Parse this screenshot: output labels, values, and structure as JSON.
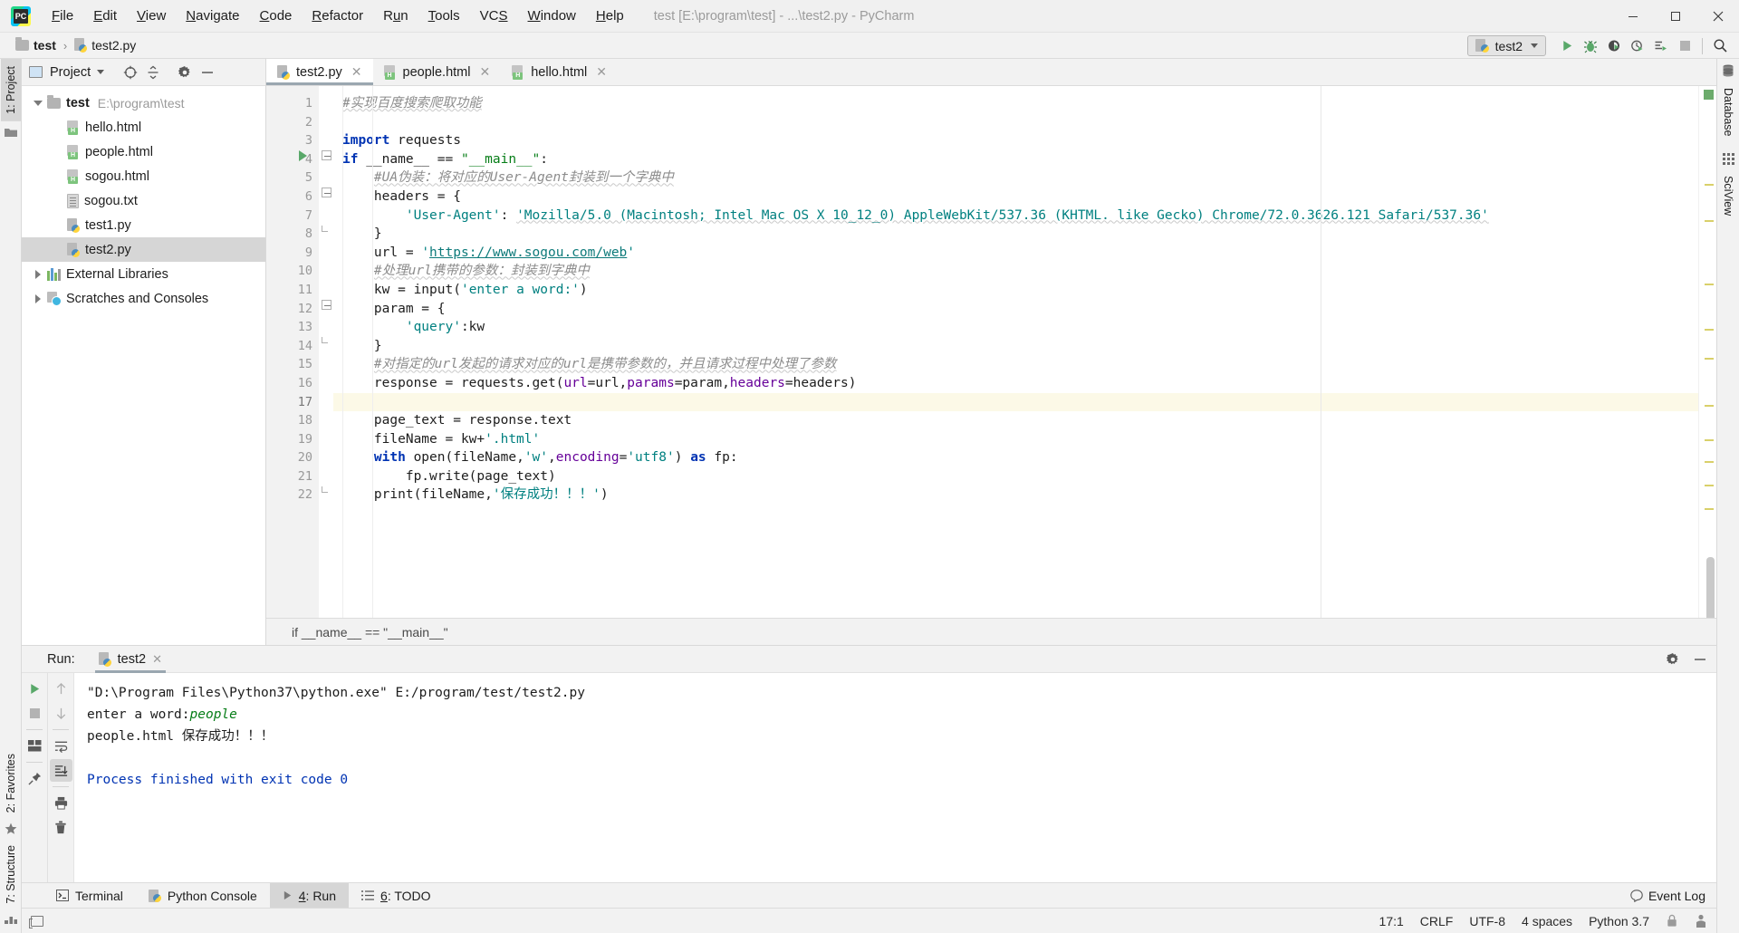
{
  "window": {
    "title": "test [E:\\program\\test] - ...\\test2.py - PyCharm",
    "app_icon": "pycharm-logo",
    "minimize": "—",
    "maximize": "❐",
    "close": "✕"
  },
  "menubar": {
    "items": [
      {
        "label": "File"
      },
      {
        "label": "Edit"
      },
      {
        "label": "View"
      },
      {
        "label": "Navigate"
      },
      {
        "label": "Code"
      },
      {
        "label": "Refactor"
      },
      {
        "label": "Run"
      },
      {
        "label": "Tools"
      },
      {
        "label": "VCS"
      },
      {
        "label": "Window"
      },
      {
        "label": "Help"
      }
    ]
  },
  "navbar": {
    "breadcrumbs": [
      {
        "label": "test",
        "icon": "folder-icon"
      },
      {
        "label": "test2.py",
        "icon": "python-file-icon"
      }
    ],
    "separator": "›",
    "run_config": {
      "label": "test2",
      "icon": "python-icon",
      "dropdown": "chevron-down-icon"
    },
    "buttons": [
      {
        "name": "run-button",
        "tip": "Run"
      },
      {
        "name": "debug-button",
        "tip": "Debug"
      },
      {
        "name": "run-with-coverage-button",
        "tip": "Run with Coverage"
      },
      {
        "name": "profile-button",
        "tip": "Profile"
      },
      {
        "name": "attach-to-process-button",
        "tip": "Attach"
      },
      {
        "name": "stop-button",
        "tip": "Stop"
      },
      {
        "name": "search-everywhere-button",
        "tip": "Search Everywhere"
      }
    ]
  },
  "left_strip": {
    "top": [
      {
        "label": "1: Project",
        "active": true
      }
    ],
    "bottom": [
      {
        "label": "2: Favorites",
        "active": false
      },
      {
        "label": "7: Structure",
        "active": false
      }
    ]
  },
  "right_strip": {
    "items": [
      {
        "label": "Database",
        "icon": "database-icon"
      },
      {
        "label": "SciView",
        "icon": "grid-icon"
      }
    ]
  },
  "project_panel": {
    "title": "Project",
    "toolbar": [
      {
        "name": "select-opened-file-button"
      },
      {
        "name": "collapse-all-button"
      },
      {
        "name": "settings-gear-button"
      },
      {
        "name": "hide-panel-button"
      }
    ],
    "tree": [
      {
        "label": "test",
        "detail": "E:\\program\\test",
        "icon": "folder-icon",
        "depth": 0,
        "expanded": true,
        "bold": true,
        "selected": false
      },
      {
        "label": "hello.html",
        "detail": "",
        "icon": "html-file-icon",
        "depth": 1,
        "selected": false
      },
      {
        "label": "people.html",
        "detail": "",
        "icon": "html-file-icon",
        "depth": 1,
        "selected": false
      },
      {
        "label": "sogou.html",
        "detail": "",
        "icon": "html-file-icon",
        "depth": 1,
        "selected": false
      },
      {
        "label": "sogou.txt",
        "detail": "",
        "icon": "text-file-icon",
        "depth": 1,
        "selected": false
      },
      {
        "label": "test1.py",
        "detail": "",
        "icon": "python-file-icon",
        "depth": 1,
        "selected": false
      },
      {
        "label": "test2.py",
        "detail": "",
        "icon": "python-file-icon",
        "depth": 1,
        "selected": true
      },
      {
        "label": "External Libraries",
        "detail": "",
        "icon": "libraries-icon",
        "depth": 0,
        "expanded": false,
        "selected": false
      },
      {
        "label": "Scratches and Consoles",
        "detail": "",
        "icon": "scratches-icon",
        "depth": 0,
        "expanded": false,
        "selected": false
      }
    ]
  },
  "editor": {
    "tabs": [
      {
        "label": "test2.py",
        "icon": "python-file-icon",
        "active": true,
        "close": "✕"
      },
      {
        "label": "people.html",
        "icon": "html-file-icon",
        "active": false,
        "close": "✕"
      },
      {
        "label": "hello.html",
        "icon": "html-file-icon",
        "active": false,
        "close": "✕"
      }
    ],
    "breadcrumb": "if __name__ == \"__main__\"",
    "caret_line": 17,
    "lines": [
      {
        "n": 1,
        "text": "#实现百度搜索爬取功能"
      },
      {
        "n": 2,
        "text": ""
      },
      {
        "n": 3,
        "text": "import requests"
      },
      {
        "n": 4,
        "text": "if __name__ == \"__main__\":"
      },
      {
        "n": 5,
        "text": "    #UA伪装：将对应的User-Agent封装到一个字典中"
      },
      {
        "n": 6,
        "text": "    headers = {"
      },
      {
        "n": 7,
        "text": "        'User-Agent': 'Mozilla/5.0 (Macintosh; Intel Mac OS X 10_12_0) AppleWebKit/537.36 (KHTML. like Gecko) Chrome/72.0.3626.121 Safari/537.36'"
      },
      {
        "n": 8,
        "text": "    }"
      },
      {
        "n": 9,
        "text": "    url = 'https://www.sogou.com/web'"
      },
      {
        "n": 10,
        "text": "    #处理url携带的参数：封装到字典中"
      },
      {
        "n": 11,
        "text": "    kw = input('enter a word:')"
      },
      {
        "n": 12,
        "text": "    param = {"
      },
      {
        "n": 13,
        "text": "        'query':kw"
      },
      {
        "n": 14,
        "text": "    }"
      },
      {
        "n": 15,
        "text": "    #对指定的url发起的请求对应的url是携带参数的，并且请求过程中处理了参数"
      },
      {
        "n": 16,
        "text": "    response = requests.get(url=url,params=param,headers=headers)"
      },
      {
        "n": 17,
        "text": ""
      },
      {
        "n": 18,
        "text": "    page_text = response.text"
      },
      {
        "n": 19,
        "text": "    fileName = kw+'.html'"
      },
      {
        "n": 20,
        "text": "    with open(fileName,'w',encoding='utf8') as fp:"
      },
      {
        "n": 21,
        "text": "        fp.write(page_text)"
      },
      {
        "n": 22,
        "text": "    print(fileName,'保存成功！！！')"
      }
    ]
  },
  "run_panel": {
    "label": "Run:",
    "tab": {
      "label": "test2",
      "icon": "python-icon",
      "close": "✕"
    },
    "header_buttons": [
      {
        "name": "settings-gear-button"
      },
      {
        "name": "hide-panel-button"
      }
    ],
    "toolbar": [
      {
        "name": "rerun-button"
      },
      {
        "name": "stop-button"
      },
      {
        "name": "layout-button"
      },
      {
        "name": "pin-tab-button"
      },
      {
        "name": "up-stacktrace-button"
      },
      {
        "name": "down-stacktrace-button"
      },
      {
        "name": "soft-wrap-button"
      },
      {
        "name": "scroll-to-end-button"
      },
      {
        "name": "print-button"
      },
      {
        "name": "clear-all-button"
      }
    ],
    "console": [
      {
        "type": "path",
        "text": "\"D:\\Program Files\\Python37\\python.exe\" E:/program/test/test2.py"
      },
      {
        "type": "prompt",
        "text": "enter a word:",
        "input": "people"
      },
      {
        "type": "output",
        "text": "people.html 保存成功！！！"
      },
      {
        "type": "blank",
        "text": ""
      },
      {
        "type": "finished",
        "text": "Process finished with exit code 0"
      }
    ]
  },
  "tool_strip": {
    "items": [
      {
        "label": "Terminal",
        "icon": "terminal-icon",
        "active": false,
        "mnemonic": ""
      },
      {
        "label": "Python Console",
        "icon": "python-icon",
        "active": false,
        "mnemonic": ""
      },
      {
        "label": "4: Run",
        "icon": "run-icon",
        "active": true,
        "mnemonic": "4"
      },
      {
        "label": "6: TODO",
        "icon": "todo-icon",
        "active": false,
        "mnemonic": "6"
      }
    ],
    "event_log": {
      "label": "Event Log",
      "icon": "balloon-icon"
    }
  },
  "status_bar": {
    "left_icon": "toggle-toolwindow-icon",
    "caret_position": "17:1",
    "line_separator": "CRLF",
    "encoding": "UTF-8",
    "indent": "4 spaces",
    "interpreter": "Python 3.7",
    "lock_icon": "lock-icon",
    "inspection_icon": "inspector-icon"
  },
  "colors": {
    "accent_green": "#59a869",
    "keyword_blue": "#0033b3",
    "string_green": "#067d17",
    "teal_string": "#008080",
    "comment_gray": "#8c8c8c",
    "kwarg_purple": "#660099",
    "caret_line": "#fcf9e7",
    "selection_gray": "#d6d6d6",
    "panel_bg": "#f2f2f2"
  }
}
